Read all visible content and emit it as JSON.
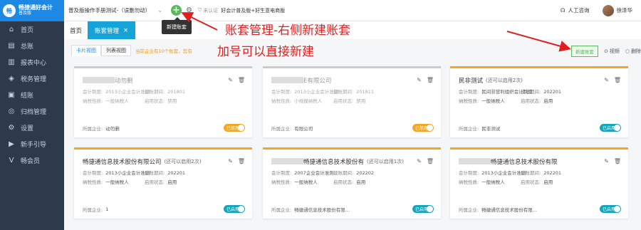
{
  "sidebar": {
    "logo_badge": "畅",
    "logo_main": "畅捷通好会计",
    "logo_sub": "普及版",
    "items": [
      {
        "icon": "home-icon",
        "glyph": "⌂",
        "label": "首页"
      },
      {
        "icon": "ledger-icon",
        "glyph": "▤",
        "label": "总账"
      },
      {
        "icon": "report-icon",
        "glyph": "▥",
        "label": "报表中心"
      },
      {
        "icon": "tax-icon",
        "glyph": "◈",
        "label": "税务管理"
      },
      {
        "icon": "closing-icon",
        "glyph": "▣",
        "label": "结账"
      },
      {
        "icon": "archive-icon",
        "glyph": "◎",
        "label": "归档管理"
      },
      {
        "icon": "settings-icon",
        "glyph": "⚙",
        "label": "设置"
      },
      {
        "icon": "guide-icon",
        "glyph": "▶",
        "label": "新手引导"
      },
      {
        "icon": "member-icon",
        "glyph": "V",
        "label": "畅会员"
      }
    ]
  },
  "topbar": {
    "account_name": "普及版操作手册测试-（误删勿动）",
    "add_icon": "plus-icon",
    "cert_label": "未认证",
    "promo": "好会计普及版+好生意电商版",
    "support_label": "人工咨询",
    "user_name": "徐泽华"
  },
  "tooltip": "新建账套",
  "tabs": {
    "home": "首页",
    "active": "账套管理",
    "close": "×"
  },
  "view": {
    "card_view": "卡片视图",
    "list_view": "列表视图",
    "hint": "当前企业有10个账套，您有",
    "new_button": "新建账套",
    "video": "视频",
    "delete": "删除"
  },
  "annotations": {
    "line1": "账套管理-右侧新建账套",
    "line2": "加号可以直接新建"
  },
  "cards": [
    {
      "title": "动勿删",
      "title_blur": true,
      "sub": "",
      "dimmed": true,
      "accounting_std": "2013小企业会计准则",
      "period": "201801",
      "taxpayer": "一般纳税人",
      "status": "禁用",
      "company": "动勿删",
      "company_blur": true,
      "toggle": "已禁用",
      "toggle_on": false
    },
    {
      "title": "E有限公司",
      "title_blur": true,
      "sub": "",
      "dimmed": true,
      "accounting_std": "2013小企业会计准则",
      "period": "201811",
      "taxpayer": "小规模纳税人",
      "status": "禁用",
      "company": "有限公司",
      "company_blur": true,
      "toggle": "已禁用",
      "toggle_on": false
    },
    {
      "title": "民非测试",
      "title_blur": false,
      "sub": "(还可以启用2次)",
      "dimmed": false,
      "accounting_std": "民间非营利组织会计制度",
      "period": "202201",
      "taxpayer": "一般纳税人",
      "status": "启用",
      "company": "民非测试",
      "company_blur": false,
      "toggle": "已启用",
      "toggle_on": true
    },
    {
      "title": "畅捷通信息技术股份有限公司",
      "title_blur": false,
      "sub": "(还可以启用2次)",
      "dimmed": false,
      "accounting_std": "2013小企业会计准则",
      "period": "202201",
      "taxpayer": "一般纳税人",
      "status": "启用",
      "company": "1",
      "company_blur": false,
      "toggle": "已启用",
      "toggle_on": true
    },
    {
      "title": "畅捷通信息技术股份有",
      "title_blur": true,
      "sub": "(还可以启用1次)",
      "dimmed": false,
      "accounting_std": "2007企业会计准则",
      "period": "202202",
      "taxpayer": "一般纳税人",
      "status": "启用",
      "company": "畅捷通信息技术股份有限...",
      "company_blur": false,
      "toggle": "已启用",
      "toggle_on": true
    },
    {
      "title": "畅捷通信息技术股份有限",
      "title_blur": true,
      "sub": "",
      "dimmed": false,
      "accounting_std": "2013小企业会计准则",
      "period": "202201",
      "taxpayer": "一般纳税人",
      "status": "启用",
      "company": "畅捷通信息技术股份有限...",
      "company_blur": false,
      "toggle": "已启用",
      "toggle_on": true
    }
  ],
  "labels": {
    "accounting_std": "会计制度:",
    "period": "建账期间:",
    "taxpayer": "纳税性质:",
    "status": "启用状态:",
    "company": "所属企业:"
  }
}
